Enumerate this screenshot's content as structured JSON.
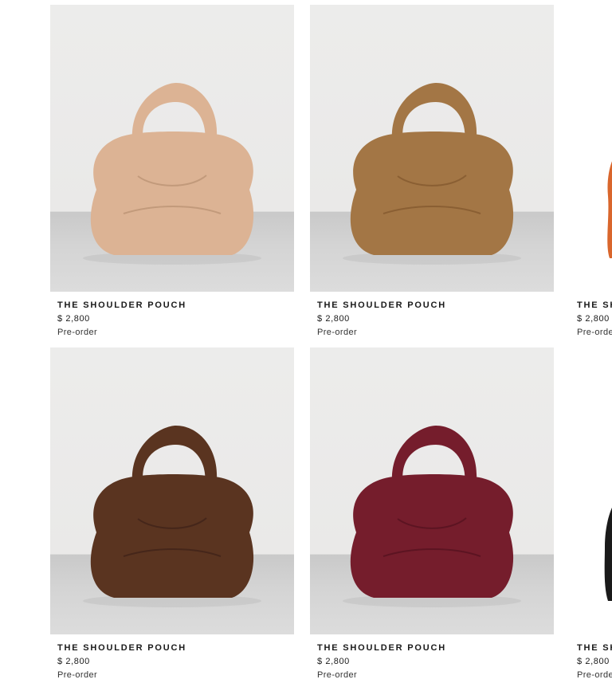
{
  "products": [
    {
      "name": "THE SHOULDER POUCH",
      "price": "$ 2,800",
      "status": "Pre-order",
      "color": "#dcb394",
      "shade": "#c29a7b"
    },
    {
      "name": "THE SHOULDER POUCH",
      "price": "$ 2,800",
      "status": "Pre-order",
      "color": "#a37645",
      "shade": "#8a5f33"
    },
    {
      "name": "THE SHOULDER POUCH",
      "price": "$ 2,800",
      "status": "Pre-order",
      "color": "#5a3420",
      "shade": "#45261a"
    },
    {
      "name": "THE SHOULDER POUCH",
      "price": "$ 2,800",
      "status": "Pre-order",
      "color": "#751d2c",
      "shade": "#5c1422"
    }
  ],
  "partial_right": [
    {
      "name": "THE SHOULDER POUCH",
      "price": "$ 2,800",
      "status": "Pre-order",
      "color": "#d9662c"
    },
    {
      "name": "THE SHOULDER POUCH",
      "price": "$ 2,800",
      "status": "Pre-order",
      "color": "#1a1a1a"
    }
  ]
}
